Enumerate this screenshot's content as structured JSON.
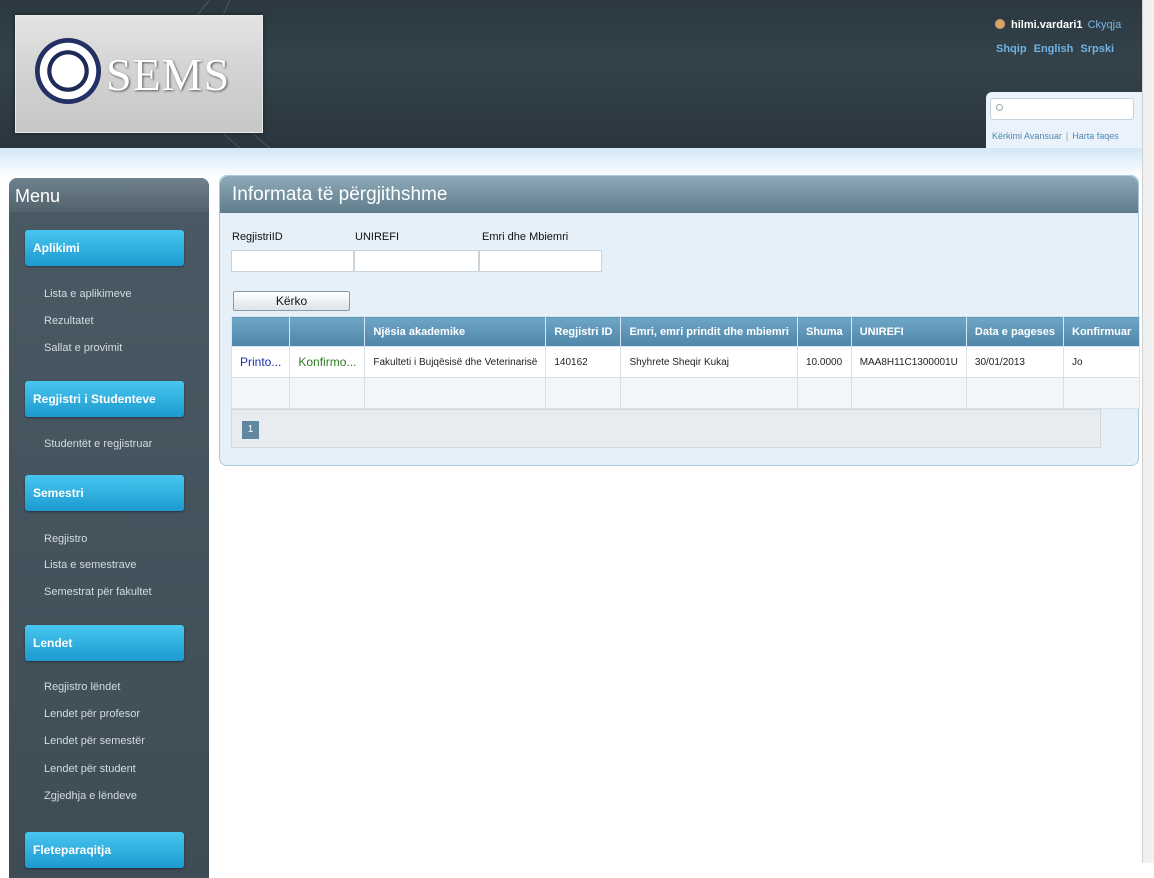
{
  "header": {
    "logo_text": "SEMS",
    "user": "hilmi.vardari1",
    "logout": "Ckyqja",
    "languages": [
      "Shqip",
      "English",
      "Srpski"
    ],
    "search": {
      "placeholder": "",
      "advanced_link": "Kërkimi Avansuar",
      "sitemap_link": "Harta faqes"
    }
  },
  "sidebar": {
    "title": "Menu",
    "sections": [
      {
        "label": "Aplikimi",
        "items": [
          "Lista e aplikimeve",
          "Rezultatet",
          "Sallat e provimit"
        ]
      },
      {
        "label": "Regjistri i Studenteve",
        "items": [
          "Studentët e regjistruar"
        ]
      },
      {
        "label": "Semestri",
        "items": [
          "Regjistro",
          "Lista e semestrave",
          "Semestrat për fakultet"
        ]
      },
      {
        "label": "Lendet",
        "items": [
          "Regjistro lëndet",
          "Lendet për profesor",
          "Lendet për semestër",
          "Lendet për student",
          "Zgjedhja e lëndeve"
        ]
      },
      {
        "label": "Fleteparaqitja",
        "items": []
      }
    ]
  },
  "main": {
    "title": "Informata të përgjithshme",
    "filters": {
      "regjistri_label": "RegjistriID",
      "unirefi_label": "UNIREFI",
      "emri_label": "Emri dhe Mbiemri",
      "regjistri_value": "",
      "unirefi_value": "",
      "emri_value": ""
    },
    "search_button": "Kërko",
    "table": {
      "headers": [
        "",
        "",
        "Njësia akademike",
        "Regjistri ID",
        "Emri, emri prindit dhe mbiemri",
        "Shuma",
        "UNIREFI",
        "Data e pageses",
        "Konfirmuar"
      ],
      "rows": [
        [
          "Printo...",
          "Konfirmo...",
          "Fakulteti i Bujqësisë dhe Veterinarisë",
          "140162",
          "Shyhrete Sheqir Kukaj",
          "10.0000",
          "MAA8H11C1300001U",
          "30/01/2013",
          "Jo"
        ]
      ]
    },
    "pager": {
      "current_page": "1"
    }
  }
}
